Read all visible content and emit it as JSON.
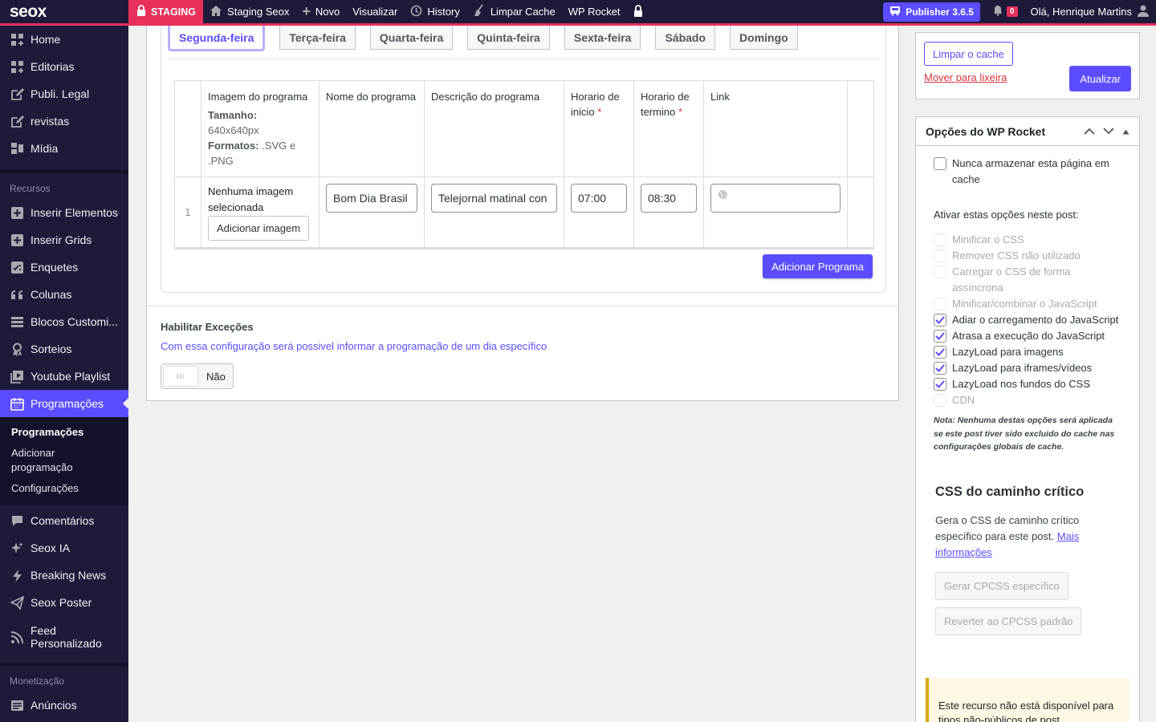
{
  "adminbar": {
    "logo": "seox",
    "staging": "STAGING",
    "site_name": "Staging Seox",
    "new": "Novo",
    "view": "Visualizar",
    "history": "History",
    "clear_cache": "Limpar Cache",
    "wp_rocket": "WP Rocket",
    "publisher": "Publisher 3.6.5",
    "notifications": "0",
    "greeting": "Olá, Henrique Martins"
  },
  "sidebar": {
    "items_top": [
      {
        "label": "Home",
        "icon": "dashboard-icon"
      },
      {
        "label": "Editorias",
        "icon": "grid-icon"
      },
      {
        "label": "Publi. Legal",
        "icon": "edit-icon"
      },
      {
        "label": "revistas",
        "icon": "edit-icon"
      },
      {
        "label": "Mídia",
        "icon": "media-icon"
      }
    ],
    "group_recursos": "Recursos",
    "items_recursos": [
      {
        "label": "Inserir Elementos",
        "icon": "plus-square-icon"
      },
      {
        "label": "Inserir Grids",
        "icon": "plus-square-icon"
      },
      {
        "label": "Enquetes",
        "icon": "poll-icon"
      },
      {
        "label": "Colunas",
        "icon": "quote-icon"
      },
      {
        "label": "Blocos Customi...",
        "icon": "blocks-icon"
      },
      {
        "label": "Sorteios",
        "icon": "award-icon"
      },
      {
        "label": "Youtube Playlist",
        "icon": "playlist-icon"
      }
    ],
    "active": {
      "label": "Programações",
      "icon": "calendar-icon"
    },
    "submenu": [
      "Programações",
      "Adicionar programação",
      "Configurações"
    ],
    "items_after": [
      {
        "label": "Comentários",
        "icon": "comment-icon"
      },
      {
        "label": "Seox IA",
        "icon": "sparkle-icon"
      },
      {
        "label": "Breaking News",
        "icon": "bolt-icon"
      },
      {
        "label": "Seox Poster",
        "icon": "send-icon"
      },
      {
        "label": "Feed Personalizado",
        "icon": "rss-icon"
      }
    ],
    "group_monet": "Monetização",
    "items_monet": [
      {
        "label": "Anúncios",
        "icon": "ads-icon"
      }
    ]
  },
  "tabs": [
    "Segunda-feira",
    "Terça-feira",
    "Quarta-feira",
    "Quinta-feira",
    "Sexta-feira",
    "Sábado",
    "Domingo"
  ],
  "table": {
    "headers": {
      "image": "Imagem do programa",
      "size_label": "Tamanho:",
      "size_value": "640x640px",
      "formats_label": "Formatos:",
      "formats_value": ".SVG e .PNG",
      "name": "Nome do programa",
      "description": "Descrição do programa",
      "start": "Horario de inicio",
      "end": "Horario de termino",
      "link": "Link",
      "required": "*"
    },
    "row": {
      "index": "1",
      "no_image": "Nenhuma imagem selecionada",
      "add_image": "Adicionar imagem",
      "name": "Bom Dia Brasil",
      "description": "Telejornal matinal con",
      "start": "07:00",
      "end": "08:30",
      "link": ""
    }
  },
  "add_program": "Adicionar Programa",
  "exceptions": {
    "label": "Habilitar Exceções",
    "description": "Com essa configuração será possivel informar a programação de um dia específico",
    "toggle_value": "Não"
  },
  "publish_box": {
    "clear_cache": "Limpar o cache",
    "trash": "Mover para lixeira",
    "update": "Atualizar"
  },
  "rocket": {
    "title": "Opções do WP Rocket",
    "never_cache": "Nunca armazenar esta página em cache",
    "activate_label": "Ativar estas opções neste post:",
    "options": [
      {
        "label": "Minificar o CSS",
        "checked": false,
        "disabled": true
      },
      {
        "label": "Remover CSS não utilizado",
        "checked": false,
        "disabled": true
      },
      {
        "label": "Carregar o CSS de forma assíncrona",
        "checked": false,
        "disabled": true
      },
      {
        "label": "Minificar/combinar o JavaScript",
        "checked": false,
        "disabled": true
      },
      {
        "label": "Adiar o carregamento do JavaScript",
        "checked": true,
        "disabled": false
      },
      {
        "label": "Atrasa a execução do JavaScript",
        "checked": true,
        "disabled": false
      },
      {
        "label": "LazyLoad para imagens",
        "checked": true,
        "disabled": false
      },
      {
        "label": "LazyLoad para iframes/vídeos",
        "checked": true,
        "disabled": false
      },
      {
        "label": "LazyLoad nos fundos do CSS",
        "checked": true,
        "disabled": false
      },
      {
        "label": "CDN",
        "checked": false,
        "disabled": true
      }
    ],
    "note": "Nota: Nenhuma destas opções será aplicada se este post tiver sido excluido do cache nas configurações globais de cache.",
    "cpcss_title": "CSS do caminho crítico",
    "cpcss_desc": "Gera o CSS de caminho crítico específico para este post.",
    "more_info": "Mais informações",
    "gen_button": "Gerar CPCSS específico",
    "revert_button": "Reverter ao CPCSS padrão",
    "warning": "Este recurso não está disponível para tipos não-públicos de post"
  },
  "colors": {
    "accent": "#5b4dff",
    "staging": "#e8305a",
    "sidebar": "#1e1b3a"
  }
}
